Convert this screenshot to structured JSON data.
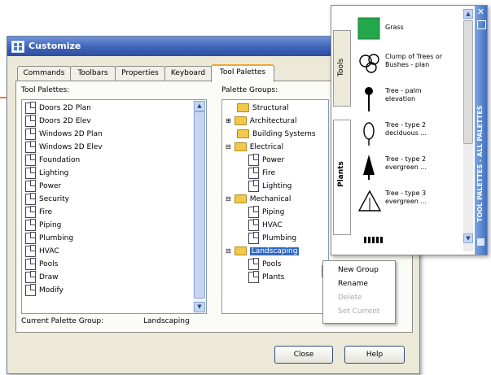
{
  "dialog": {
    "title": "Customize",
    "tabs": [
      {
        "label": "Commands"
      },
      {
        "label": "Toolbars"
      },
      {
        "label": "Properties"
      },
      {
        "label": "Keyboard"
      },
      {
        "label": "Tool Palettes"
      }
    ],
    "tool_palettes_label": "Tool Palettes:",
    "palette_groups_label": "Palette Groups:",
    "tool_palettes": [
      "Doors 2D Plan",
      "Doors 2D Elev",
      "Windows 2D Plan",
      "Windows 2D Elev",
      "Foundation",
      "Lighting",
      "Power",
      "Security",
      "Fire",
      "Piping",
      "Plumbing",
      "HVAC",
      "Pools",
      "Draw",
      "Modify"
    ],
    "palette_groups": {
      "structural": "Structural",
      "architectural": "Architectural",
      "building_systems": "Building Systems",
      "electrical": "Electrical",
      "power": "Power",
      "fire": "Fire",
      "lighting": "Lighting",
      "mechanical": "Mechanical",
      "piping": "Piping",
      "hvac": "HVAC",
      "plumbing": "Plumbing",
      "landscaping": "Landscaping",
      "pools": "Pools",
      "plants": "Plants"
    },
    "current_group_label": "Current Palette Group:",
    "current_group_value": "Landscaping",
    "close_label": "Close",
    "help_label": "Help"
  },
  "context_menu": {
    "new_group": "New Group",
    "rename": "Rename",
    "delete": "Delete",
    "set_current": "Set Current"
  },
  "palette_window": {
    "side_title": "TOOL PALETTES - ALL PALETTES",
    "tabs": {
      "tools": "Tools",
      "plants": "Plants"
    },
    "tools": [
      {
        "label": "Grass",
        "icon": "grass-icon"
      },
      {
        "label": "Clump of Trees or Bushes - plan",
        "icon": "tree-clump-icon"
      },
      {
        "label": "Tree - palm elevation",
        "icon": "palm-tree-icon"
      },
      {
        "label": "Tree - type 2 deciduous ...",
        "icon": "deciduous-tree-icon"
      },
      {
        "label": "Tree - type 2 evergreen ...",
        "icon": "evergreen-tree-icon"
      },
      {
        "label": "Tree - type 3 evergreen ...",
        "icon": "evergreen-tree-icon"
      }
    ]
  },
  "colors": {
    "titlebar": "#3f63b8",
    "selection": "#316ac5",
    "callout_arrow": "#d8541e",
    "grass": "#22a84a"
  }
}
